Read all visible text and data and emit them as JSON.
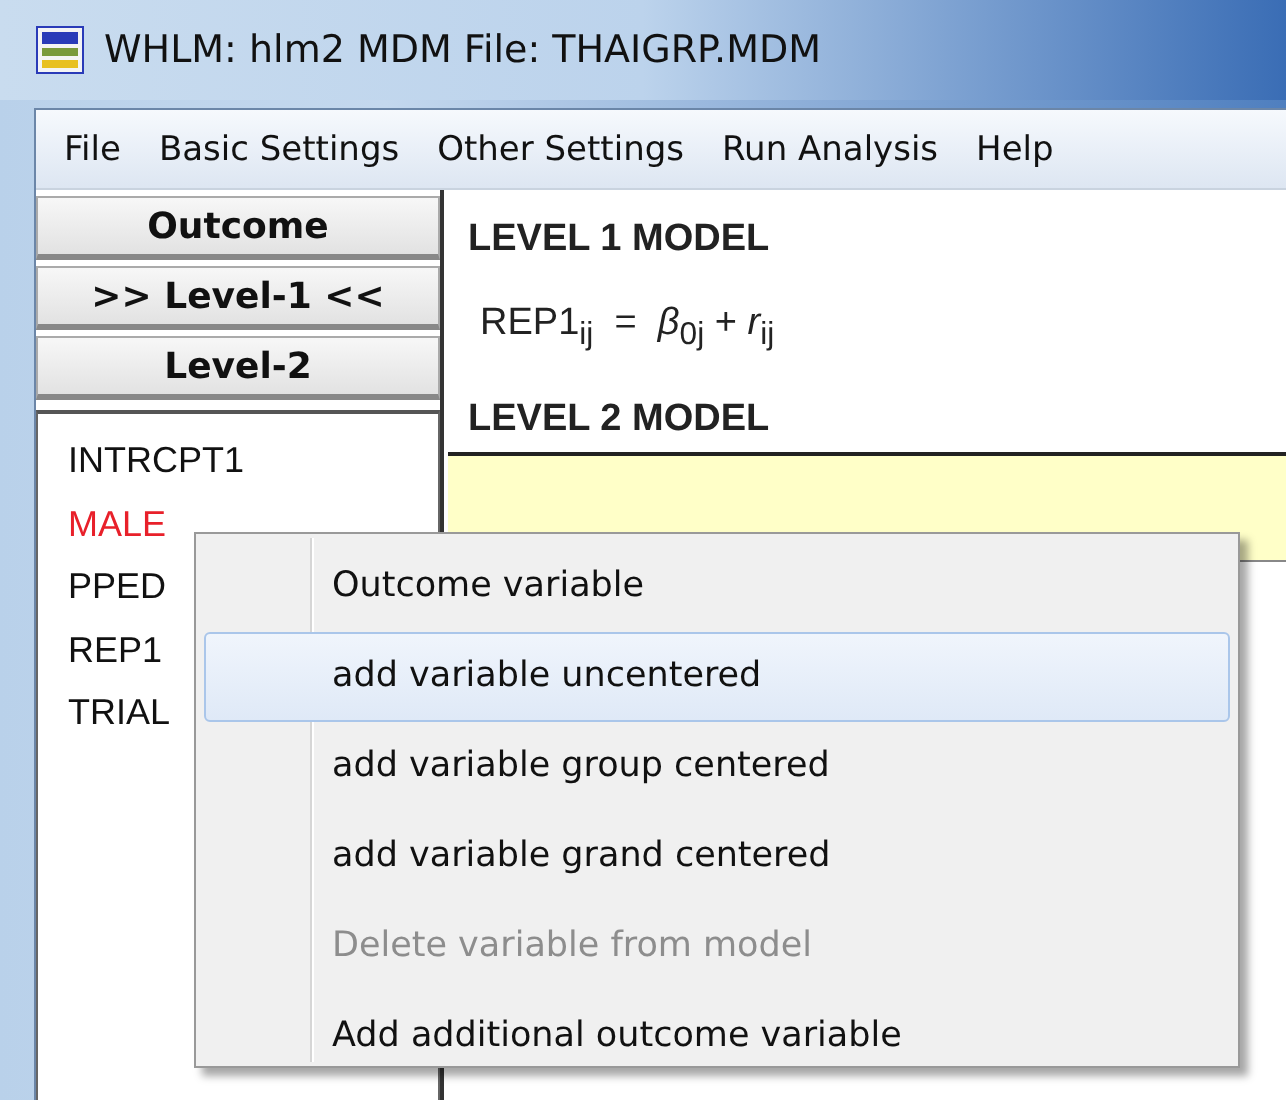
{
  "window": {
    "title": "WHLM: hlm2 MDM File: THAIGRP.MDM"
  },
  "menu_bar": [
    "File",
    "Basic Settings",
    "Other Settings",
    "Run Analysis",
    "Help"
  ],
  "level_buttons": [
    {
      "label": "Outcome"
    },
    {
      "label": ">> Level-1 <<"
    },
    {
      "label": "Level-2"
    }
  ],
  "variables": [
    {
      "name": "INTRCPT1",
      "color": "#111111"
    },
    {
      "name": "MALE",
      "color": "#e8202a"
    },
    {
      "name": "PPED",
      "color": "#111111"
    },
    {
      "name": "REP1",
      "color": "#111111"
    },
    {
      "name": "TRIAL",
      "color": "#111111"
    }
  ],
  "model": {
    "level1_heading": "LEVEL 1 MODEL",
    "level1_equation": "REP1$_{ij}$  =  *β*$_{0j}$ + *r*$_{ij}$",
    "level2_heading": "LEVEL 2 MODEL"
  },
  "context_menu": [
    {
      "label": "Outcome variable",
      "highlighted": false,
      "disabled": false
    },
    {
      "label": "add variable uncentered",
      "highlighted": true,
      "disabled": false
    },
    {
      "label": "add variable group centered",
      "highlighted": false,
      "disabled": false
    },
    {
      "label": "add variable grand centered",
      "highlighted": false,
      "disabled": false
    },
    {
      "label": "Delete variable from model",
      "highlighted": false,
      "disabled": true
    },
    {
      "label": "Add additional outcome variable",
      "highlighted": false,
      "disabled": false
    }
  ]
}
